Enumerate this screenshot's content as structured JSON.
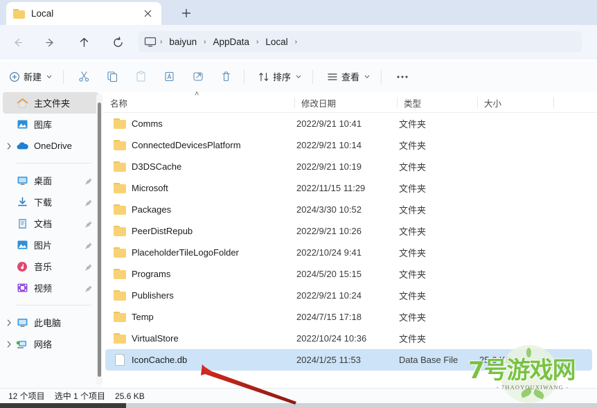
{
  "window": {
    "tab": {
      "label": "Local",
      "folder_icon": "folder-icon",
      "close_icon": "close-icon"
    },
    "new_tab_label": "+"
  },
  "nav": {
    "back": {
      "name": "back-button",
      "glyph": "back-arrow-icon",
      "enabled": false
    },
    "forward": {
      "name": "forward-button",
      "glyph": "forward-arrow-icon",
      "enabled": true
    },
    "up": {
      "name": "up-button",
      "glyph": "up-arrow-icon",
      "enabled": true
    },
    "refresh": {
      "name": "refresh-button",
      "glyph": "refresh-icon",
      "enabled": true
    }
  },
  "address": {
    "root_icon": "monitor-icon",
    "crumbs": [
      "baiyun",
      "AppData",
      "Local"
    ],
    "chevron": "›"
  },
  "toolbar": {
    "new_label": "新建",
    "new_icon": "plus-circle-icon",
    "cut_icon": "scissors-icon",
    "copy_icon": "copy-icon",
    "paste_icon": "paste-icon",
    "rename_icon": "rename-icon",
    "share_icon": "share-icon",
    "delete_icon": "trash-icon",
    "sort_label": "排序",
    "sort_icon": "sort-icon",
    "view_label": "查看",
    "view_icon": "view-list-icon",
    "more_label": "•••",
    "caret": "⌄"
  },
  "sidebar": {
    "items": [
      {
        "label": "主文件夹",
        "icon": "home-icon",
        "selected": true,
        "expander": false,
        "pin": false
      },
      {
        "label": "图库",
        "icon": "gallery-icon",
        "selected": false,
        "expander": false,
        "pin": false
      },
      {
        "label": "OneDrive",
        "icon": "cloud-icon",
        "selected": false,
        "expander": true,
        "pin": false
      },
      {
        "divider": true
      },
      {
        "label": "桌面",
        "icon": "desktop-icon",
        "selected": false,
        "expander": false,
        "pin": true
      },
      {
        "label": "下载",
        "icon": "download-icon",
        "selected": false,
        "expander": false,
        "pin": true
      },
      {
        "label": "文档",
        "icon": "documents-icon",
        "selected": false,
        "expander": false,
        "pin": true
      },
      {
        "label": "图片",
        "icon": "pictures-icon",
        "selected": false,
        "expander": false,
        "pin": true
      },
      {
        "label": "音乐",
        "icon": "music-icon",
        "selected": false,
        "expander": false,
        "pin": true
      },
      {
        "label": "视频",
        "icon": "videos-icon",
        "selected": false,
        "expander": false,
        "pin": true
      },
      {
        "divider": true
      },
      {
        "label": "此电脑",
        "icon": "this-pc-icon",
        "selected": false,
        "expander": true,
        "pin": false
      },
      {
        "label": "网络",
        "icon": "network-icon",
        "selected": false,
        "expander": true,
        "pin": false
      }
    ]
  },
  "file_pane": {
    "columns": [
      {
        "label": "名称",
        "key": "name"
      },
      {
        "label": "修改日期",
        "key": "date"
      },
      {
        "label": "类型",
        "key": "type"
      },
      {
        "label": "大小",
        "key": "size"
      }
    ],
    "sort_indicator": "˄",
    "rows": [
      {
        "name": "Comms",
        "date": "2022/9/21 10:41",
        "type": "文件夹",
        "size": "",
        "icon": "folder-icon",
        "selected": false
      },
      {
        "name": "ConnectedDevicesPlatform",
        "date": "2022/9/21 10:14",
        "type": "文件夹",
        "size": "",
        "icon": "folder-icon",
        "selected": false
      },
      {
        "name": "D3DSCache",
        "date": "2022/9/21 10:19",
        "type": "文件夹",
        "size": "",
        "icon": "folder-icon",
        "selected": false
      },
      {
        "name": "Microsoft",
        "date": "2022/11/15 11:29",
        "type": "文件夹",
        "size": "",
        "icon": "folder-icon",
        "selected": false
      },
      {
        "name": "Packages",
        "date": "2024/3/30 10:52",
        "type": "文件夹",
        "size": "",
        "icon": "folder-icon",
        "selected": false
      },
      {
        "name": "PeerDistRepub",
        "date": "2022/9/21 10:26",
        "type": "文件夹",
        "size": "",
        "icon": "folder-icon",
        "selected": false
      },
      {
        "name": "PlaceholderTileLogoFolder",
        "date": "2022/10/24 9:41",
        "type": "文件夹",
        "size": "",
        "icon": "folder-icon",
        "selected": false
      },
      {
        "name": "Programs",
        "date": "2024/5/20 15:15",
        "type": "文件夹",
        "size": "",
        "icon": "folder-icon",
        "selected": false
      },
      {
        "name": "Publishers",
        "date": "2022/9/21 10:24",
        "type": "文件夹",
        "size": "",
        "icon": "folder-icon",
        "selected": false
      },
      {
        "name": "Temp",
        "date": "2024/7/15 17:18",
        "type": "文件夹",
        "size": "",
        "icon": "folder-icon",
        "selected": false
      },
      {
        "name": "VirtualStore",
        "date": "2022/10/24 10:36",
        "type": "文件夹",
        "size": "",
        "icon": "folder-icon",
        "selected": false
      },
      {
        "name": "IconCache.db",
        "date": "2024/1/25 11:53",
        "type": "Data Base File",
        "size": "25.6 KB",
        "icon": "database-file-icon",
        "selected": true
      }
    ]
  },
  "status": {
    "item_count": "12 个项目",
    "selection": "选中 1 个项目",
    "selection_size": "25.6 KB"
  },
  "watermark": {
    "title": "7号游戏网",
    "subtitle": "- 7HAOYOUXIWANG -",
    "color": "#79c242"
  },
  "annotation": {
    "arrow": "red-arrow-pointer",
    "color": "#d42a20"
  },
  "colors": {
    "tabstrip_bg": "#dbe4f3",
    "chrome_bg": "#f9fbfd",
    "address_bg": "#eaeff8",
    "selection_blue": "#cde3f7",
    "sidebar_selected": "#e2e2e2",
    "folder_yellow": "#f8d274"
  }
}
